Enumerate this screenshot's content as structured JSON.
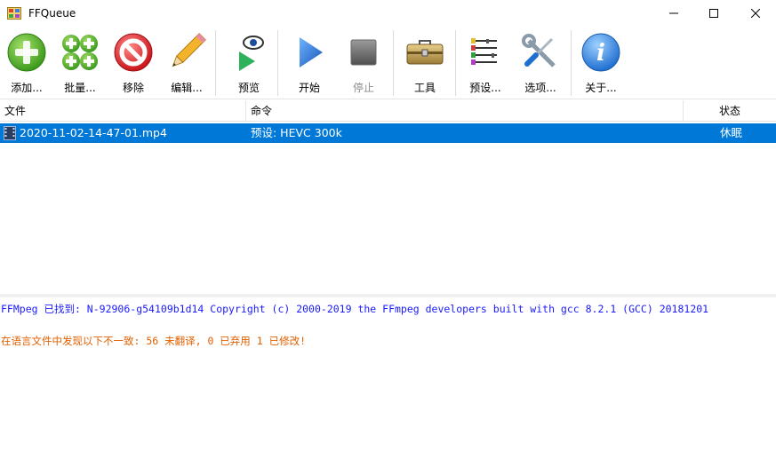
{
  "window": {
    "title": "FFQueue",
    "controls": {
      "minimize": "minimize",
      "maximize": "maximize",
      "close": "close"
    }
  },
  "toolbar": {
    "add": "添加...",
    "batch": "批量...",
    "remove": "移除",
    "edit": "编辑...",
    "preview": "预览",
    "start": "开始",
    "stop": "停止",
    "tools": "工具",
    "presets": "预设...",
    "options": "选项...",
    "about": "关于..."
  },
  "list": {
    "columns": {
      "file": "文件",
      "command": "命令",
      "status": "状态"
    },
    "rows": [
      {
        "file": "2020-11-02-14-47-01.mp4",
        "command": "预设: HEVC 300k",
        "status": "休眠",
        "selected": true
      }
    ]
  },
  "log": {
    "lines": [
      {
        "text": "FFMpeg 已找到: N-92906-g54109b1d14 Copyright (c) 2000-2019 the FFmpeg developers built with gcc 8.2.1 (GCC) 20181201",
        "color": "#1a1aff"
      },
      {
        "text": "在语言文件中发现以下不一致: 56 未翻译, 0 已弃用  1 已修改!",
        "color": "#e06000"
      }
    ]
  },
  "colors": {
    "selection": "#0078d7",
    "log_info": "#1a1aff",
    "log_warning": "#e06000"
  }
}
